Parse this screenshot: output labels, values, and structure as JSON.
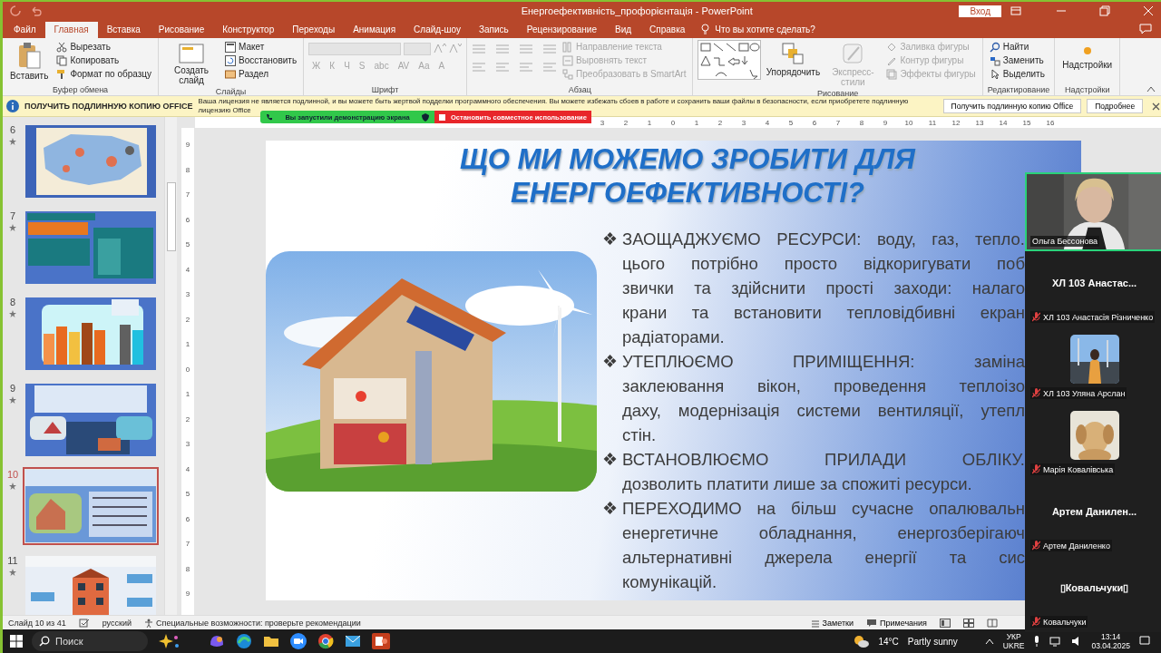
{
  "window": {
    "title": "Енергоефективність_профорієнтація  -  PowerPoint",
    "sign_in": "Вход"
  },
  "tabs": [
    {
      "label": "Файл",
      "selected": false
    },
    {
      "label": "Главная",
      "selected": true
    },
    {
      "label": "Вставка",
      "selected": false
    },
    {
      "label": "Рисование",
      "selected": false
    },
    {
      "label": "Конструктор",
      "selected": false
    },
    {
      "label": "Переходы",
      "selected": false
    },
    {
      "label": "Анимация",
      "selected": false
    },
    {
      "label": "Слайд-шоу",
      "selected": false
    },
    {
      "label": "Запись",
      "selected": false
    },
    {
      "label": "Рецензирование",
      "selected": false
    },
    {
      "label": "Вид",
      "selected": false
    },
    {
      "label": "Справка",
      "selected": false
    }
  ],
  "tell_me": "Что вы хотите сделать?",
  "ribbon": [
    {
      "kind": "clipboard",
      "label": "Буфер обмена",
      "large": [
        {
          "label": "Вставить",
          "disabled": false
        }
      ],
      "items": [
        {
          "label": "Вырезать",
          "disabled": false
        },
        {
          "label": "Копировать",
          "disabled": false
        },
        {
          "label": "Формат по образцу",
          "disabled": false
        }
      ]
    },
    {
      "kind": "slides",
      "label": "Слайды",
      "large": [
        {
          "label": "Создать слайд",
          "disabled": false
        }
      ],
      "items": [
        {
          "label": "Макет",
          "disabled": false
        },
        {
          "label": "Восстановить",
          "disabled": false
        },
        {
          "label": "Раздел",
          "disabled": false
        }
      ]
    },
    {
      "kind": "font",
      "label": "Шрифт",
      "items": [
        {
          "label": "Ж",
          "disabled": true
        },
        {
          "label": "К",
          "disabled": true
        },
        {
          "label": "Ч",
          "disabled": true
        },
        {
          "label": "S",
          "disabled": true
        },
        {
          "label": "abc",
          "disabled": true
        },
        {
          "label": "AV",
          "disabled": true
        },
        {
          "label": "Aa",
          "disabled": true
        },
        {
          "label": "A",
          "disabled": true
        }
      ]
    },
    {
      "kind": "paragraph",
      "label": "Абзац",
      "items": [
        {
          "label": "Направление текста",
          "disabled": true
        },
        {
          "label": "Выровнять текст",
          "disabled": true
        },
        {
          "label": "Преобразовать в SmartArt",
          "disabled": true
        }
      ]
    },
    {
      "kind": "drawing",
      "label": "Рисование",
      "large": [
        {
          "label": "Упорядочить",
          "disabled": false
        },
        {
          "label": "Экспресс-стили",
          "disabled": true
        }
      ],
      "items": [
        {
          "label": "Заливка фигуры",
          "disabled": true
        },
        {
          "label": "Контур фигуры",
          "disabled": true
        },
        {
          "label": "Эффекты фигуры",
          "disabled": true
        }
      ]
    },
    {
      "kind": "editing",
      "label": "Редактирование",
      "items": [
        {
          "label": "Найти",
          "disabled": false
        },
        {
          "label": "Заменить",
          "disabled": false
        },
        {
          "label": "Выделить",
          "disabled": false
        }
      ]
    },
    {
      "kind": "addins",
      "label": "Надстройки",
      "large": [
        {
          "label": "Надстройки",
          "disabled": false
        }
      ]
    }
  ],
  "license_bar": {
    "title": "ПОЛУЧИТЬ ПОДЛИННУЮ КОПИЮ OFFICE",
    "message": "Ваша лицензия не является подлинной, и вы можете быть жертвой подделки программного обеспечения. Вы можете избежать сбоев в работе и сохранить ваши файлы в безопасности, если приобретете подлинную лицензию Office",
    "buttons": [
      "Получить подлинную копию Office",
      "Подробнее"
    ]
  },
  "share_bar": {
    "status": "Вы запустили демонстрацию экрана",
    "stop": "Остановить совместное использование"
  },
  "thumbnails": [
    {
      "number": "6",
      "selected": false
    },
    {
      "number": "7",
      "selected": false
    },
    {
      "number": "8",
      "selected": false
    },
    {
      "number": "9",
      "selected": false
    },
    {
      "number": "10",
      "selected": true
    },
    {
      "number": "11",
      "selected": false
    }
  ],
  "ruler": {
    "horizontal": [
      "3",
      "2",
      "1",
      "0",
      "1",
      "2",
      "3",
      "4",
      "5",
      "6",
      "7",
      "8",
      "9",
      "10",
      "11",
      "12",
      "13",
      "14",
      "15",
      "16"
    ],
    "vertical": [
      "9",
      "8",
      "7",
      "6",
      "5",
      "4",
      "3",
      "2",
      "1",
      "0",
      "1",
      "2",
      "3",
      "4",
      "5",
      "6",
      "7",
      "8",
      "9"
    ]
  },
  "slide": {
    "title": "ЩО МИ МОЖЕМО ЗРОБИТИ ДЛЯ ЕНЕРГОЕФЕКТИВНОСТІ?",
    "bullets": [
      {
        "marker": "❖",
        "lines": [
          "ЗАОЩАДЖУЄМО РЕСУРСИ: воду, газ, тепло.",
          "цього потрібно просто відкоригувати поб",
          "звички та здійснити прості заходи: налаго",
          "крани та встановити тепловідбивні екран",
          "радіаторами."
        ]
      },
      {
        "marker": "❖",
        "lines": [
          "УТЕПЛЮЄМО ПРИМІЩЕННЯ: заміна",
          "заклеювання вікон, проведення теплоізо",
          "даху, модернізація системи вентиляції, утепл",
          "стін."
        ]
      },
      {
        "marker": "❖",
        "lines": [
          "ВСТАНОВЛЮЄМО ПРИЛАДИ ОБЛІКУ.",
          "дозволить платити лише за спожиті ресурси."
        ]
      },
      {
        "marker": "❖",
        "lines": [
          "ПЕРЕХОДИМО на більш сучасне опалювальн",
          "енергетичне обладнання, енергозберігаюч",
          "альтернативні джерела енергії та сис",
          "комунікацій."
        ]
      }
    ]
  },
  "status_bar": {
    "slide_counter": "Слайд 10 из 41",
    "language": "русский",
    "accessibility": "Специальные возможности: проверьте рекомендации",
    "notes": "Заметки",
    "comments": "Примечания"
  },
  "participants": [
    {
      "kind": "video",
      "label": "Ольга Бессонова",
      "active": true,
      "muted": false
    },
    {
      "kind": "name",
      "title": "ХЛ 103 Анастас...",
      "label": "ХЛ 103 Анастасія Різниченко",
      "active": false,
      "muted": true
    },
    {
      "kind": "avatar",
      "label": "ХЛ 103 Уляна Арслан",
      "active": false,
      "muted": true
    },
    {
      "kind": "avatar",
      "label": "Марія Ковалівська",
      "active": false,
      "muted": true
    },
    {
      "kind": "name",
      "title": "Артем  Данилен...",
      "label": "Артем Даниленко",
      "active": false,
      "muted": true
    },
    {
      "kind": "name",
      "title": "▯Ковальчуки▯",
      "label": "Ковальчуки",
      "active": false,
      "muted": true
    }
  ],
  "taskbar": {
    "search": "Поиск",
    "temperature": "14°C",
    "weather": "Partly sunny",
    "language": [
      "УКР",
      "UKRE"
    ],
    "time": "13:14",
    "date": "03.04.2025"
  }
}
